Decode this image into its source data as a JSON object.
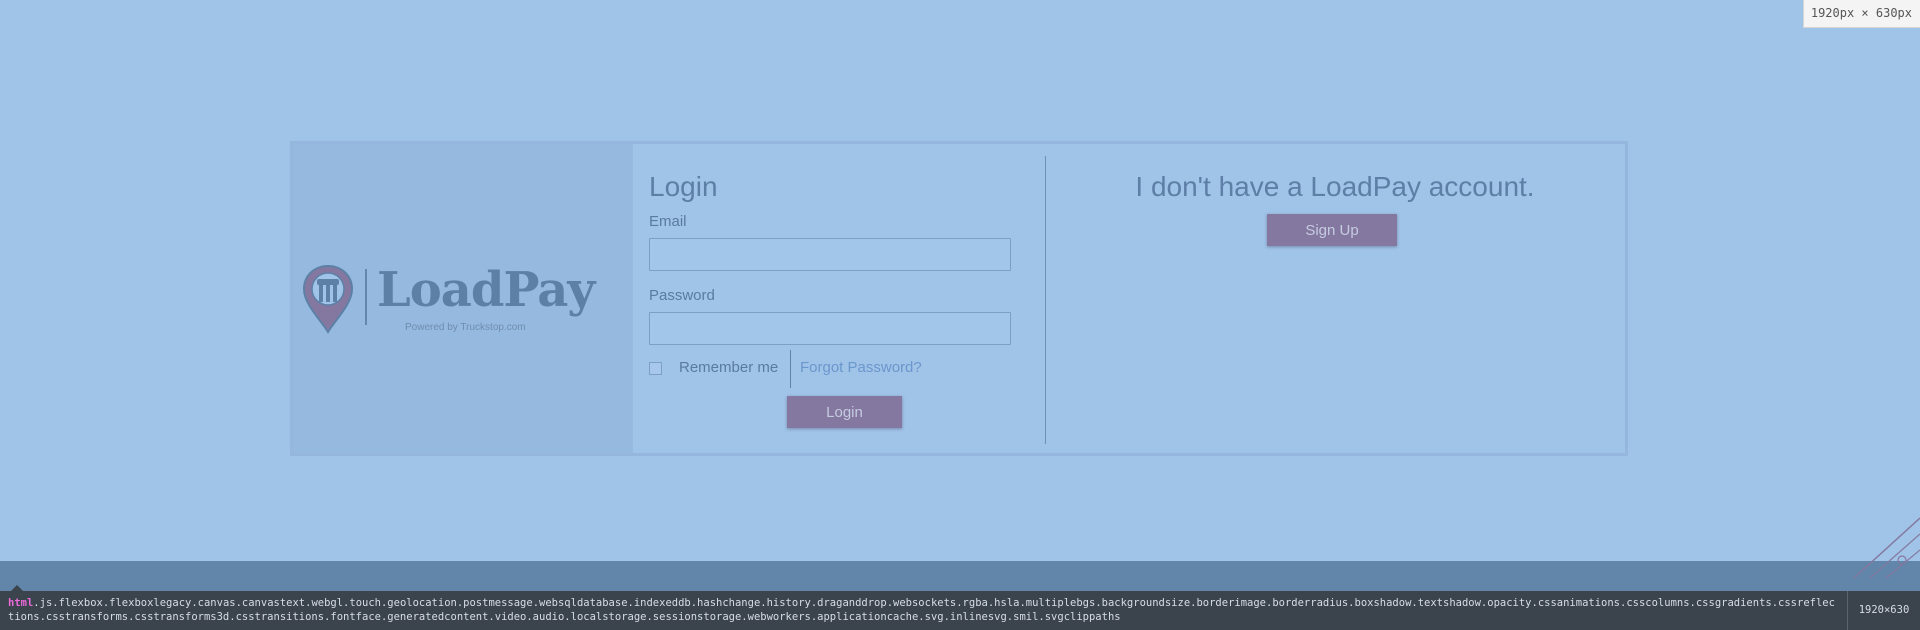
{
  "viewport_badge": "1920px × 630px",
  "logo": {
    "name": "LoadPay",
    "tagline": "Powered by Truckstop.com",
    "color": "#5d81a6",
    "pin_color": "#8478a0"
  },
  "login": {
    "title": "Login",
    "email_label": "Email",
    "email_value": "",
    "password_label": "Password",
    "password_value": "",
    "remember_label": "Remember me",
    "remember_checked": false,
    "forgot_link": "Forgot Password?",
    "submit_label": "Login"
  },
  "signup": {
    "title": "I don't have a LoadPay account.",
    "button_label": "Sign Up"
  },
  "debug_bar": {
    "tag": "html",
    "classes": ".js.flexbox.flexboxlegacy.canvas.canvastext.webgl.touch.geolocation.postmessage.websqldatabase.indexeddb.hashchange.history.draganddrop.websockets.rgba.hsla.multiplebgs.backgroundsize.borderimage.borderradius.boxshadow.textshadow.opacity.cssanimations.csscolumns.cssgradients.cssreflections.csstransforms.csstransforms3d.csstransitions.fontface.generatedcontent.video.audio.localstorage.sessionstorage.webworkers.applicationcache.svg.inlinesvg.smil.svgclippaths",
    "size": "1920×630"
  },
  "colors": {
    "background": "#a0c3e8",
    "button": "#8478a0",
    "link": "#6b97cd"
  }
}
